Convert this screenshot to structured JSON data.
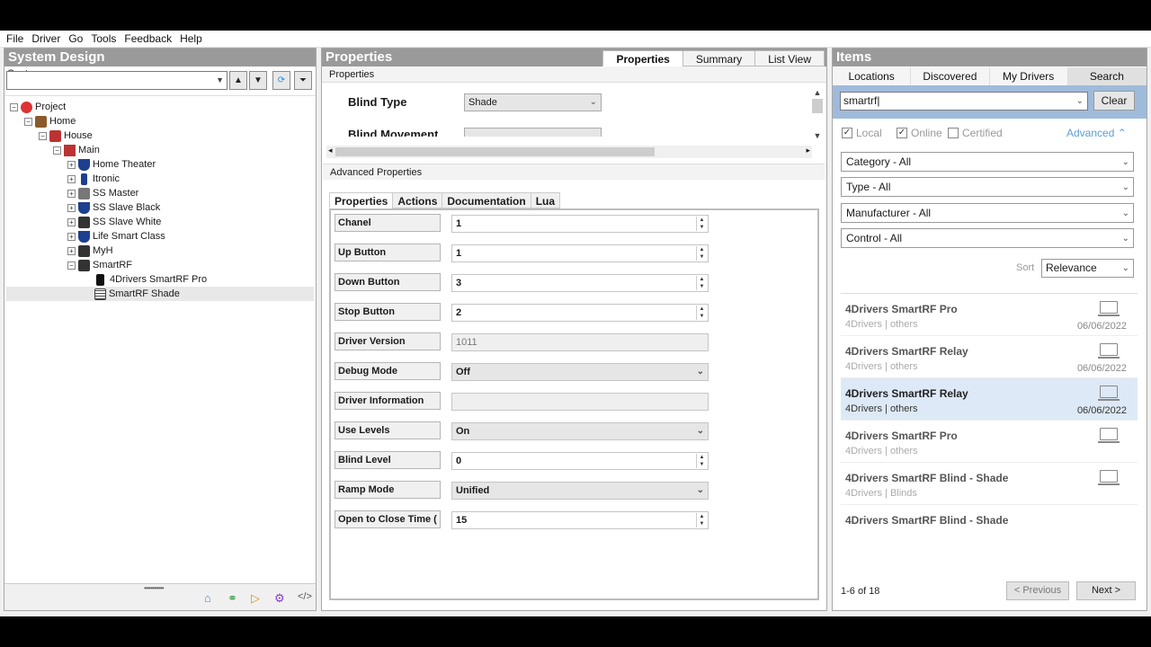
{
  "menu": [
    {
      "label": "File"
    },
    {
      "label": "Driver"
    },
    {
      "label": "Go"
    },
    {
      "label": "Tools"
    },
    {
      "label": "Feedback"
    },
    {
      "label": "Help"
    }
  ],
  "system": {
    "title": "System Design",
    "label": "System",
    "tree": [
      {
        "label": "Project",
        "icon": "project-icon",
        "color": "#d33"
      },
      {
        "label": "Home",
        "icon": "home-icon",
        "color": "#8a5a2b"
      },
      {
        "label": "House",
        "icon": "house-icon",
        "color": "#b33"
      },
      {
        "label": "Main",
        "icon": "room-icon",
        "color": "#b33"
      },
      {
        "label": "Home Theater",
        "icon": "shield-icon",
        "color": "#1d3f8f"
      },
      {
        "label": "Itronic",
        "icon": "remote-icon",
        "color": "#1d3f8f"
      },
      {
        "label": "SS Master",
        "icon": "device-icon",
        "color": "#555"
      },
      {
        "label": "SS Slave Black",
        "icon": "shield-icon",
        "color": "#1d3f8f"
      },
      {
        "label": "SS Slave White",
        "icon": "device-icon",
        "color": "#333"
      },
      {
        "label": "Life Smart Class",
        "icon": "shield-icon",
        "color": "#1d3f8f"
      },
      {
        "label": "MyH",
        "icon": "device-icon",
        "color": "#333"
      },
      {
        "label": "SmartRF",
        "icon": "device-icon",
        "color": "#333"
      },
      {
        "label": "4Drivers SmartRF Pro",
        "icon": "phone-icon",
        "color": "#111"
      },
      {
        "label": "SmartRF Shade",
        "icon": "grid-icon",
        "color": "#444"
      }
    ]
  },
  "properties": {
    "title": "Properties",
    "tabs": [
      "Properties",
      "Summary",
      "List View"
    ],
    "sub_header": "Properties",
    "blind_type_label": "Blind Type",
    "blind_type_value": "Shade",
    "blind_movement_label": "Blind Movement",
    "advanced_header": "Advanced Properties",
    "inner_tabs": [
      "Properties",
      "Actions",
      "Documentation",
      "Lua"
    ],
    "rows": [
      {
        "label": "Chanel",
        "value": "1",
        "kind": "spin"
      },
      {
        "label": "Up Button",
        "value": "1",
        "kind": "spin"
      },
      {
        "label": "Down Button",
        "value": "3",
        "kind": "spin"
      },
      {
        "label": "Stop Button",
        "value": "2",
        "kind": "spin"
      },
      {
        "label": "Driver Version",
        "value": "1011",
        "kind": "ro"
      },
      {
        "label": "Debug Mode",
        "value": "Off",
        "kind": "combo"
      },
      {
        "label": "Driver Information",
        "value": "",
        "kind": "ro"
      },
      {
        "label": "Use Levels",
        "value": "On",
        "kind": "combo"
      },
      {
        "label": "Blind Level",
        "value": "0",
        "kind": "spin"
      },
      {
        "label": "Ramp Mode",
        "value": "Unified",
        "kind": "combo"
      },
      {
        "label": "Open to Close Time (",
        "value": "15",
        "kind": "spin"
      }
    ]
  },
  "items": {
    "title": "Items",
    "tabs": [
      "Locations",
      "Discovered",
      "My Drivers",
      "Search"
    ],
    "search_value": "smartrf|",
    "clear_label": "Clear",
    "checks": [
      {
        "label": "Local",
        "checked": true
      },
      {
        "label": "Online",
        "checked": true
      },
      {
        "label": "Certified",
        "checked": false
      }
    ],
    "advanced_label": "Advanced",
    "filters": [
      "Category - All",
      "Type - All",
      "Manufacturer - All",
      "Control - All"
    ],
    "sort_label": "Sort",
    "sort_value": "Relevance",
    "results": [
      {
        "title": "4Drivers SmartRF Pro",
        "maker": "4Drivers",
        "sep": "|",
        "cat": "others",
        "date": "06/06/2022"
      },
      {
        "title": "4Drivers SmartRF Relay",
        "maker": "4Drivers",
        "sep": "|",
        "cat": "others",
        "date": "06/06/2022"
      },
      {
        "title": "4Drivers SmartRF Relay",
        "maker": "4Drivers",
        "sep": "|",
        "cat": "others",
        "date": "06/06/2022"
      },
      {
        "title": "4Drivers SmartRF Pro",
        "maker": "4Drivers",
        "sep": "|",
        "cat": "others",
        "date": ""
      },
      {
        "title": "4Drivers SmartRF Blind - Shade",
        "maker": "4Drivers",
        "sep": "|",
        "cat": "Blinds",
        "date": ""
      },
      {
        "title": "4Drivers SmartRF Blind - Shade",
        "maker": "",
        "sep": "",
        "cat": "",
        "date": ""
      }
    ],
    "paging": "1-6 of 18",
    "prev_label": "< Previous",
    "next_label": "Next >"
  }
}
